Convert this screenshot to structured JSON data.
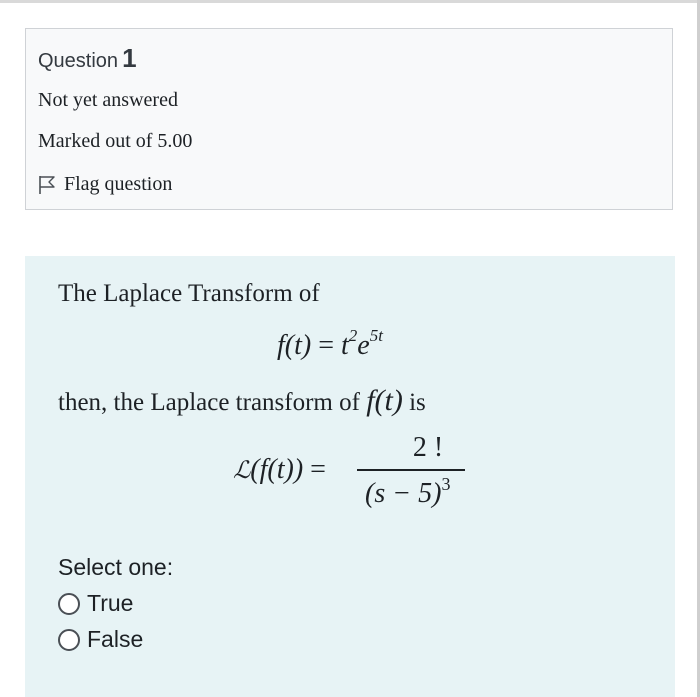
{
  "question": {
    "label": "Question",
    "number": "1",
    "state": "Not yet answered",
    "grade": "Marked out of 5.00",
    "flag_label": "Flag question"
  },
  "content": {
    "intro": "The Laplace Transform of",
    "then_prefix": "then, the Laplace transform of ",
    "then_suffix": " is",
    "formula1": {
      "lhs": "f(t)",
      "eq": " = ",
      "base": "t",
      "exp1": "2",
      "mid": "e",
      "exp2": "5t"
    },
    "formula_ft": "f(t)",
    "formula2": {
      "lhs_script": "ℒ",
      "lhs_rest": "(f(t))",
      "eq": " =",
      "numerator": "2 !",
      "denominator": "(s − 5)",
      "den_exp": "3"
    },
    "select_label": "Select one:",
    "options": [
      {
        "label": "True"
      },
      {
        "label": "False"
      }
    ]
  },
  "colors": {
    "info_bg": "#f8f9fa",
    "content_bg": "#e7f3f5",
    "border": "#cfd2d6"
  },
  "icons": {
    "flag": "flag-icon"
  }
}
